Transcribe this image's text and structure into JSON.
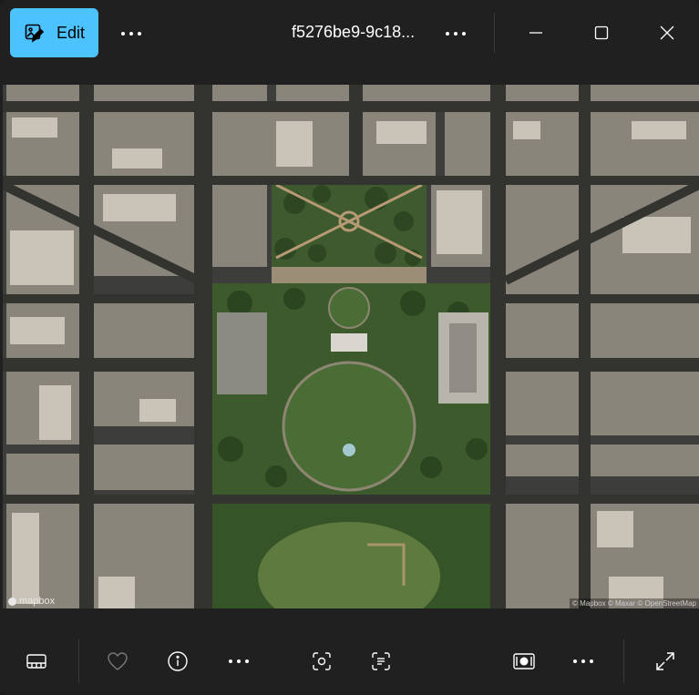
{
  "toolbar": {
    "edit_label": "Edit",
    "file_name": "f5276be9-9c18..."
  },
  "map": {
    "attribution_left": "mapbox",
    "attribution_right": "© Mapbox © Maxar © OpenStreetMap"
  },
  "icons": {
    "edit": "edit-image-icon",
    "more": "more-icon",
    "minimize": "minimize-icon",
    "maximize": "maximize-icon",
    "close": "close-icon",
    "filmstrip": "filmstrip-icon",
    "favorite": "heart-icon",
    "info": "info-icon",
    "visual_search": "visual-search-icon",
    "text_scan": "text-scan-icon",
    "slideshow": "slideshow-icon",
    "fullscreen": "fullscreen-icon"
  },
  "colors": {
    "accent": "#4cc2ff",
    "background": "#202020"
  }
}
